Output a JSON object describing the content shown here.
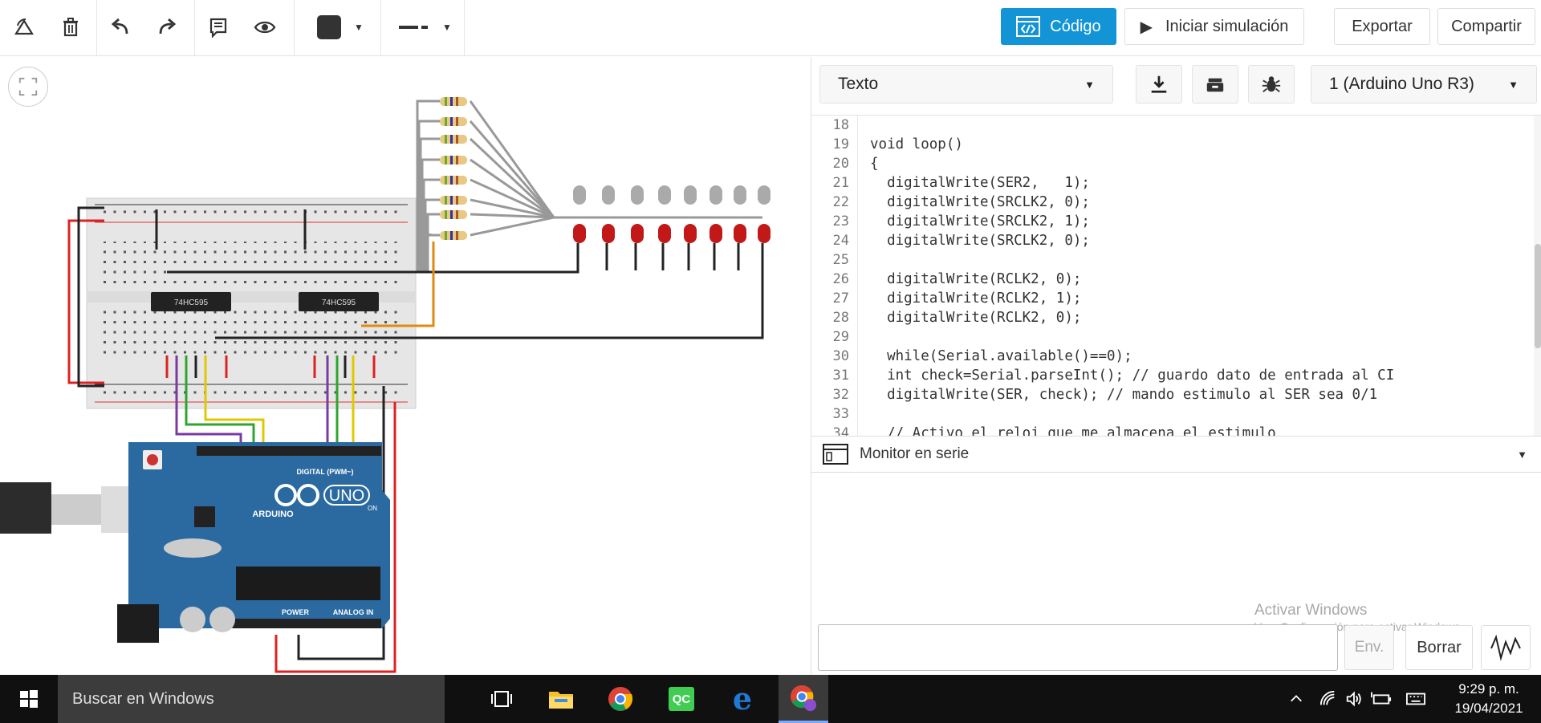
{
  "toolbar": {
    "codigo_label": "Código",
    "simulate_label": "Iniciar simulación",
    "export_label": "Exportar",
    "share_label": "Compartir"
  },
  "code_panel": {
    "mode": "Texto",
    "board": "1 (Arduino Uno R3)"
  },
  "editor": {
    "line_numbers": [
      "18",
      "19",
      "20",
      "21",
      "22",
      "23",
      "24",
      "25",
      "26",
      "27",
      "28",
      "29",
      "30",
      "31",
      "32",
      "33",
      "34"
    ],
    "lines": [
      "",
      "void loop()",
      "{",
      "  digitalWrite(SER2,   1);",
      "  digitalWrite(SRCLK2, 0);",
      "  digitalWrite(SRCLK2, 1);",
      "  digitalWrite(SRCLK2, 0);",
      "",
      "  digitalWrite(RCLK2, 0);",
      "  digitalWrite(RCLK2, 1);",
      "  digitalWrite(RCLK2, 0);",
      "",
      "  while(Serial.available()==0);",
      "  int check=Serial.parseInt(); // guardo dato de entrada al CI",
      "  digitalWrite(SER, check); // mando estimulo al SER sea 0/1",
      "",
      "  // Activo el reloj que me almacena el estimulo"
    ]
  },
  "serial": {
    "title": "Monitor en serie",
    "send_label": "Env.",
    "clear_label": "Borrar",
    "input_value": ""
  },
  "watermark": {
    "line1": "Activar Windows",
    "line2": "Ve a Configuración para activar Windows."
  },
  "circuit": {
    "ic1_label": "74HC595",
    "ic2_label": "74HC595",
    "arduino_brand": "ARDUINO",
    "arduino_model": "UNO",
    "digital_label": "DIGITAL (PWM~)",
    "power_label": "POWER",
    "analog_label": "ANALOG IN",
    "on_label": "ON"
  },
  "taskbar": {
    "search_placeholder": "Buscar en Windows",
    "time": "9:29 p. m.",
    "date": "19/04/2021"
  }
}
